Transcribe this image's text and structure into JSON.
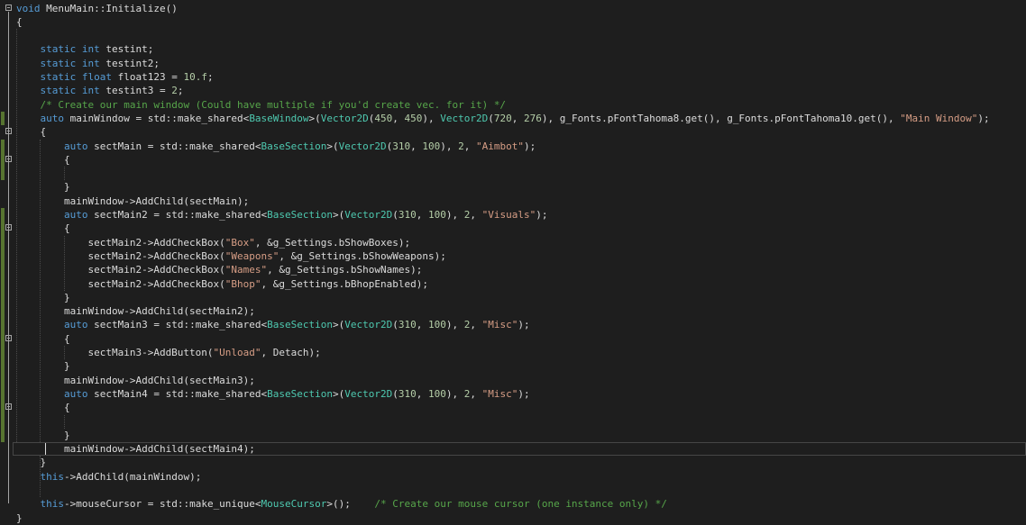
{
  "colors": {
    "background": "#1e1e1e",
    "keyword": "#569cd6",
    "type": "#4ec9b0",
    "string": "#d69d85",
    "comment": "#57a64a",
    "number": "#b5cea8",
    "default": "#dcdcdc",
    "change_margin": "#577430"
  },
  "lines": [
    {
      "fold": true,
      "tokens": [
        [
          "kw",
          "void"
        ],
        [
          "d",
          " MenuMain::Initialize()"
        ]
      ]
    },
    {
      "tokens": [
        [
          "d",
          "{"
        ]
      ]
    },
    {
      "tokens": []
    },
    {
      "tokens": [
        [
          "d",
          "    "
        ],
        [
          "kw",
          "static"
        ],
        [
          "d",
          " "
        ],
        [
          "kw",
          "int"
        ],
        [
          "d",
          " testint;"
        ]
      ]
    },
    {
      "tokens": [
        [
          "d",
          "    "
        ],
        [
          "kw",
          "static"
        ],
        [
          "d",
          " "
        ],
        [
          "kw",
          "int"
        ],
        [
          "d",
          " testint2;"
        ]
      ]
    },
    {
      "tokens": [
        [
          "d",
          "    "
        ],
        [
          "kw",
          "static"
        ],
        [
          "d",
          " "
        ],
        [
          "kw",
          "float"
        ],
        [
          "d",
          " float123 = "
        ],
        [
          "num",
          "10.f"
        ],
        [
          "d",
          ";"
        ]
      ]
    },
    {
      "tokens": [
        [
          "d",
          "    "
        ],
        [
          "kw",
          "static"
        ],
        [
          "d",
          " "
        ],
        [
          "kw",
          "int"
        ],
        [
          "d",
          " testint3 = "
        ],
        [
          "num",
          "2"
        ],
        [
          "d",
          ";"
        ]
      ]
    },
    {
      "tokens": [
        [
          "d",
          "    "
        ],
        [
          "cm",
          "/* Create our main window (Could have multiple if you'd create vec. for it) */"
        ]
      ]
    },
    {
      "tokens": [
        [
          "d",
          "    "
        ],
        [
          "kw",
          "auto"
        ],
        [
          "d",
          " mainWindow = std::make_shared<"
        ],
        [
          "ty",
          "BaseWindow"
        ],
        [
          "d",
          ">("
        ],
        [
          "ty",
          "Vector2D"
        ],
        [
          "d",
          "("
        ],
        [
          "num",
          "450"
        ],
        [
          "d",
          ", "
        ],
        [
          "num",
          "450"
        ],
        [
          "d",
          "), "
        ],
        [
          "ty",
          "Vector2D"
        ],
        [
          "d",
          "("
        ],
        [
          "num",
          "720"
        ],
        [
          "d",
          ", "
        ],
        [
          "num",
          "276"
        ],
        [
          "d",
          "), g_Fonts.pFontTahoma8.get(), g_Fonts.pFontTahoma10.get(), "
        ],
        [
          "str",
          "\"Main Window\""
        ],
        [
          "d",
          ");"
        ]
      ]
    },
    {
      "fold": true,
      "tokens": [
        [
          "d",
          "    {"
        ]
      ]
    },
    {
      "tokens": [
        [
          "d",
          "        "
        ],
        [
          "kw",
          "auto"
        ],
        [
          "d",
          " sectMain = std::make_shared<"
        ],
        [
          "ty",
          "BaseSection"
        ],
        [
          "d",
          ">("
        ],
        [
          "ty",
          "Vector2D"
        ],
        [
          "d",
          "("
        ],
        [
          "num",
          "310"
        ],
        [
          "d",
          ", "
        ],
        [
          "num",
          "100"
        ],
        [
          "d",
          "), "
        ],
        [
          "num",
          "2"
        ],
        [
          "d",
          ", "
        ],
        [
          "str",
          "\"Aimbot\""
        ],
        [
          "d",
          ");"
        ]
      ]
    },
    {
      "fold": true,
      "tokens": [
        [
          "d",
          "        {"
        ]
      ]
    },
    {
      "tokens": []
    },
    {
      "tokens": [
        [
          "d",
          "        }"
        ]
      ]
    },
    {
      "tokens": [
        [
          "d",
          "        mainWindow->AddChild(sectMain);"
        ]
      ]
    },
    {
      "tokens": [
        [
          "d",
          "        "
        ],
        [
          "kw",
          "auto"
        ],
        [
          "d",
          " sectMain2 = std::make_shared<"
        ],
        [
          "ty",
          "BaseSection"
        ],
        [
          "d",
          ">("
        ],
        [
          "ty",
          "Vector2D"
        ],
        [
          "d",
          "("
        ],
        [
          "num",
          "310"
        ],
        [
          "d",
          ", "
        ],
        [
          "num",
          "100"
        ],
        [
          "d",
          "), "
        ],
        [
          "num",
          "2"
        ],
        [
          "d",
          ", "
        ],
        [
          "str",
          "\"Visuals\""
        ],
        [
          "d",
          ");"
        ]
      ]
    },
    {
      "fold": true,
      "tokens": [
        [
          "d",
          "        {"
        ]
      ]
    },
    {
      "tokens": [
        [
          "d",
          "            sectMain2->AddCheckBox("
        ],
        [
          "str",
          "\"Box\""
        ],
        [
          "d",
          ", &g_Settings.bShowBoxes);"
        ]
      ]
    },
    {
      "tokens": [
        [
          "d",
          "            sectMain2->AddCheckBox("
        ],
        [
          "str",
          "\"Weapons\""
        ],
        [
          "d",
          ", &g_Settings.bShowWeapons);"
        ]
      ]
    },
    {
      "tokens": [
        [
          "d",
          "            sectMain2->AddCheckBox("
        ],
        [
          "str",
          "\"Names\""
        ],
        [
          "d",
          ", &g_Settings.bShowNames);"
        ]
      ]
    },
    {
      "tokens": [
        [
          "d",
          "            sectMain2->AddCheckBox("
        ],
        [
          "str",
          "\"Bhop\""
        ],
        [
          "d",
          ", &g_Settings.bBhopEnabled);"
        ]
      ]
    },
    {
      "tokens": [
        [
          "d",
          "        }"
        ]
      ]
    },
    {
      "tokens": [
        [
          "d",
          "        mainWindow->AddChild(sectMain2);"
        ]
      ]
    },
    {
      "tokens": [
        [
          "d",
          "        "
        ],
        [
          "kw",
          "auto"
        ],
        [
          "d",
          " sectMain3 = std::make_shared<"
        ],
        [
          "ty",
          "BaseSection"
        ],
        [
          "d",
          ">("
        ],
        [
          "ty",
          "Vector2D"
        ],
        [
          "d",
          "("
        ],
        [
          "num",
          "310"
        ],
        [
          "d",
          ", "
        ],
        [
          "num",
          "100"
        ],
        [
          "d",
          "), "
        ],
        [
          "num",
          "2"
        ],
        [
          "d",
          ", "
        ],
        [
          "str",
          "\"Misc\""
        ],
        [
          "d",
          ");"
        ]
      ]
    },
    {
      "fold": true,
      "tokens": [
        [
          "d",
          "        {"
        ]
      ]
    },
    {
      "tokens": [
        [
          "d",
          "            sectMain3->AddButton("
        ],
        [
          "str",
          "\"Unload\""
        ],
        [
          "d",
          ", Detach);"
        ]
      ]
    },
    {
      "tokens": [
        [
          "d",
          "        }"
        ]
      ]
    },
    {
      "tokens": [
        [
          "d",
          "        mainWindow->AddChild(sectMain3);"
        ]
      ]
    },
    {
      "tokens": [
        [
          "d",
          "        "
        ],
        [
          "kw",
          "auto"
        ],
        [
          "d",
          " sectMain4 = std::make_shared<"
        ],
        [
          "ty",
          "BaseSection"
        ],
        [
          "d",
          ">("
        ],
        [
          "ty",
          "Vector2D"
        ],
        [
          "d",
          "("
        ],
        [
          "num",
          "310"
        ],
        [
          "d",
          ", "
        ],
        [
          "num",
          "100"
        ],
        [
          "d",
          "), "
        ],
        [
          "num",
          "2"
        ],
        [
          "d",
          ", "
        ],
        [
          "str",
          "\"Misc\""
        ],
        [
          "d",
          ");"
        ]
      ]
    },
    {
      "fold": true,
      "tokens": [
        [
          "d",
          "        {"
        ]
      ]
    },
    {
      "tokens": []
    },
    {
      "tokens": [
        [
          "d",
          "        }"
        ]
      ]
    },
    {
      "tokens": [
        [
          "d",
          "        mainWindow->AddChild(sectMain4);"
        ]
      ]
    },
    {
      "tokens": [
        [
          "d",
          "    }"
        ]
      ]
    },
    {
      "tokens": [
        [
          "d",
          "    "
        ],
        [
          "kw",
          "this"
        ],
        [
          "d",
          "->AddChild(mainWindow);"
        ]
      ]
    },
    {
      "tokens": []
    },
    {
      "tokens": [
        [
          "d",
          "    "
        ],
        [
          "kw",
          "this"
        ],
        [
          "d",
          "->mouseCursor = std::make_unique<"
        ],
        [
          "ty",
          "MouseCursor"
        ],
        [
          "d",
          ">();    "
        ],
        [
          "cm",
          "/* Create our mouse cursor (one instance only) */"
        ]
      ]
    },
    {
      "tokens": [
        [
          "d",
          "}"
        ]
      ]
    }
  ]
}
